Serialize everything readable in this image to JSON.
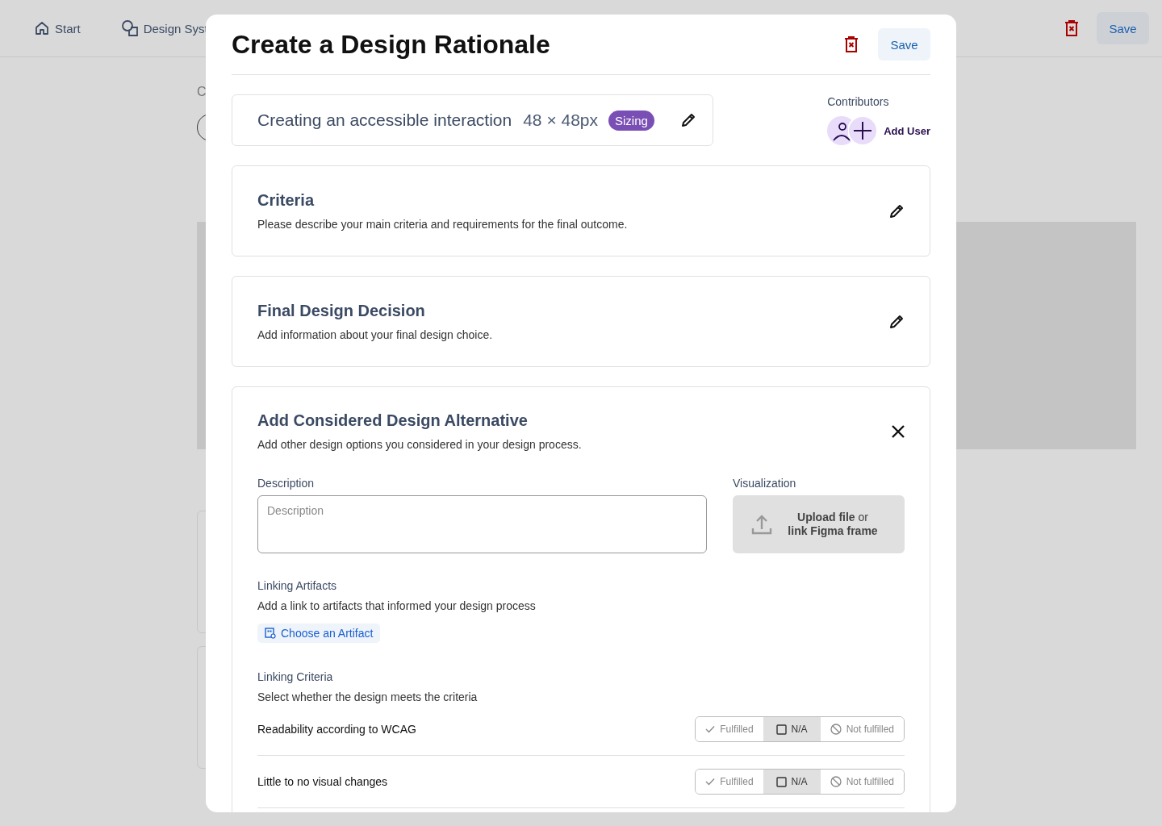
{
  "topbar": {
    "nav": [
      {
        "label": "Start"
      },
      {
        "label": "Design Syst"
      }
    ],
    "save": "Save"
  },
  "background": {
    "heading_1": "C"
  },
  "modal": {
    "title": "Create a Design Rationale",
    "save": "Save",
    "rationale": {
      "title": "Creating an accessible interaction",
      "size": "48 × 48px",
      "tag": "Sizing"
    },
    "contributors": {
      "label": "Contributors",
      "add": "Add User"
    },
    "sections": [
      {
        "title": "Criteria",
        "text": "Please describe your main criteria and requirements for the final outcome."
      },
      {
        "title": "Final Design Decision",
        "text": "Add information about your final design choice."
      }
    ],
    "alternative": {
      "title": "Add Considered Design Alternative",
      "text": "Add other design options you considered in your design process.",
      "description": {
        "label": "Description",
        "placeholder": "Description"
      },
      "visualization": {
        "label": "Visualization",
        "upload": "**Upload file** or **link Figma frame**"
      },
      "artifacts": {
        "label": "Linking Artifacts",
        "text": "Add a link to artifacts that informed your design process",
        "button": "Choose an Artifact"
      },
      "criteria": {
        "label": "Linking Criteria",
        "text": "Select whether the design meets the criteria",
        "rows": [
          {
            "name": "Readability according to WCAG",
            "options": [
              {
                "kind": "check",
                "label": "Fulfilled",
                "selected": false
              },
              {
                "kind": "square",
                "label": "N/A",
                "selected": true
              },
              {
                "kind": "ban",
                "label": "Not fulfilled",
                "selected": false
              }
            ]
          },
          {
            "name": "Little to no visual changes",
            "options": [
              {
                "kind": "check",
                "label": "Fulfilled",
                "selected": false
              },
              {
                "kind": "square",
                "label": "N/A",
                "selected": true
              },
              {
                "kind": "ban",
                "label": "Not fulfilled",
                "selected": false
              }
            ]
          }
        ]
      }
    }
  }
}
